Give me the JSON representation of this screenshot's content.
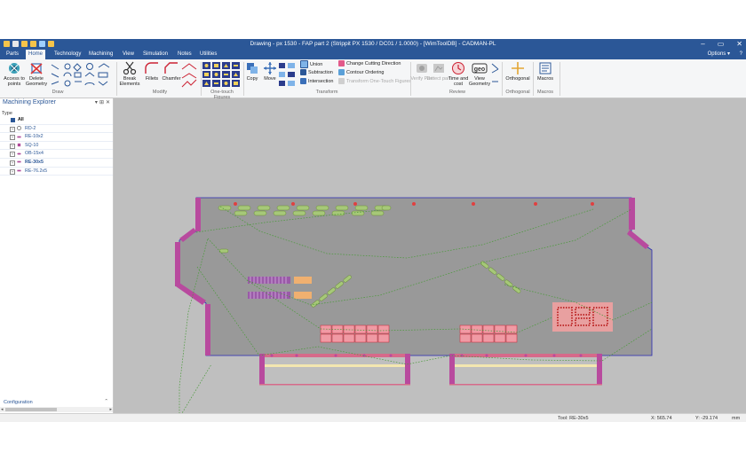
{
  "window": {
    "title": "Drawing - px 1530 - FAP part 2  (Strippit PX 1530 / DC01 / 1.0000) - [WimToolDB] - CADMAN-PL",
    "controls": [
      "–",
      "▭",
      "✕"
    ]
  },
  "ribbon": {
    "tabs": [
      "Parts",
      "Home",
      "Technology",
      "Machining",
      "View",
      "Simulation",
      "Notes",
      "Utilities"
    ],
    "active_tab": "Home",
    "options_label": "Options",
    "draw": {
      "label": "Draw",
      "access_points": "Access to points",
      "delete_geometry": "Delete Geometry"
    },
    "modify": {
      "label": "Modify",
      "break_elements": "Break Elements",
      "fillets": "Fillets",
      "chamfer": "Chamfer"
    },
    "one_touch": {
      "label": "One-touch Figures"
    },
    "transform": {
      "label": "Transform",
      "copy": "Copy",
      "move": "Move",
      "union": "Union",
      "subtraction": "Subtraction",
      "intersection": "Intersection",
      "change_cutting_direction": "Change Cutting Direction",
      "contour_ordering": "Contour Ordering",
      "transform_one_touch": "Transform One-Touch Figures"
    },
    "review": {
      "label": "Review",
      "verify_part": "Verify Part",
      "detect_part": "Detect part",
      "time_and_cost": "Time and cost",
      "view_geometry": "View Geometry"
    },
    "orthogonal": {
      "label": "Orthogonal",
      "button": "Orthogonal"
    },
    "macros": {
      "label": "Macros",
      "button": "Macros"
    }
  },
  "explorer": {
    "title": "Machining Explorer",
    "controls": [
      "▾",
      "⊞",
      "✕"
    ],
    "column_type": "Type",
    "root": "All",
    "items": [
      {
        "label": "RD-2",
        "icon_color": "#9a9a9a"
      },
      {
        "label": "RE-10x2",
        "icon_color": "#b04a9a"
      },
      {
        "label": "SQ-10",
        "icon_color": "#b04a9a"
      },
      {
        "label": "OB-15x4",
        "icon_color": "#b04a9a"
      },
      {
        "label": "RE-30x5",
        "icon_color": "#b04a9a"
      },
      {
        "label": "RE-76.2x5",
        "icon_color": "#b04a9a"
      }
    ],
    "footer": "Configuration"
  },
  "status": {
    "tool": "Tool: RE-30x5",
    "x": "X: 565.74",
    "y": "Y: -29.174",
    "unit": "mm"
  },
  "colors": {
    "title_bar": "#2b5797",
    "sheet": "#999999",
    "sheet_border": "#2828b4",
    "tool_magenta": "#b84a9e",
    "tool_pink": "#f09aa4",
    "tool_green": "#a6c878",
    "toolpath": "#4a9a3a",
    "canvas": "#bfbfbf"
  }
}
